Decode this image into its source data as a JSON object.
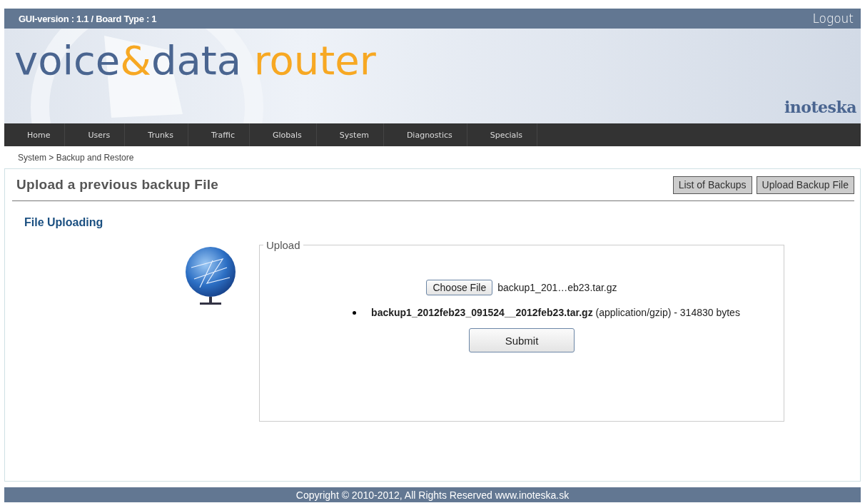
{
  "top_bar": {
    "version": "GUI-version : 1.1 / Board Type : 1",
    "logout": "Logout"
  },
  "banner": {
    "logo": [
      {
        "text": "voice",
        "color": "#4a6590"
      },
      {
        "text": "&",
        "color": "#f7a823"
      },
      {
        "text": "data",
        "color": "#4a6590"
      },
      {
        "text": " router",
        "color": "#f7a823"
      }
    ],
    "brand": "inoteska"
  },
  "nav": [
    "Home",
    "Users",
    "Trunks",
    "Traffic",
    "Globals",
    "System",
    "Diagnostics",
    "Specials"
  ],
  "breadcrumb": "System > Backup and Restore",
  "panel": {
    "title": "Upload a previous backup File",
    "buttons": [
      "List of Backups",
      "Upload Backup File"
    ]
  },
  "section_title": "File Uploading",
  "upload": {
    "legend": "Upload",
    "choose_button": "Choose File",
    "chosen_file": "backup1_201…eb23.tar.gz",
    "files": [
      "**backup1_2012feb23_091524__2012feb23.tar.gz** (application/gzip) - 314830 bytes"
    ],
    "submit": "Submit"
  },
  "footer": "Copyright © 2010-2012, All Rights Reserved www.inoteska.sk"
}
